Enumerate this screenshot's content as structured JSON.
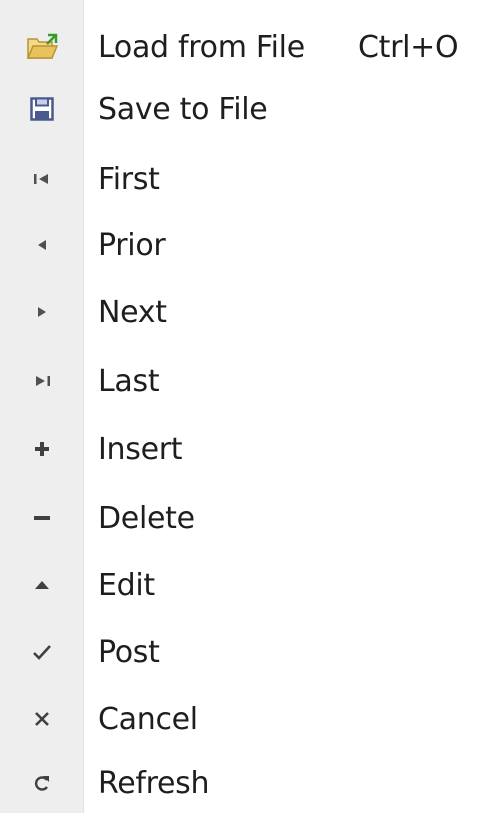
{
  "menu": {
    "items": [
      {
        "label": "Load from File",
        "shortcut": "Ctrl+O",
        "icon": "folder-open-icon"
      },
      {
        "label": "Save to File",
        "shortcut": "",
        "icon": "floppy-disk-icon"
      },
      {
        "label": "First",
        "shortcut": "",
        "icon": "first-record-icon"
      },
      {
        "label": "Prior",
        "shortcut": "",
        "icon": "prior-record-icon"
      },
      {
        "label": "Next",
        "shortcut": "",
        "icon": "next-record-icon"
      },
      {
        "label": "Last",
        "shortcut": "",
        "icon": "last-record-icon"
      },
      {
        "label": "Insert",
        "shortcut": "",
        "icon": "plus-icon"
      },
      {
        "label": "Delete",
        "shortcut": "",
        "icon": "minus-icon"
      },
      {
        "label": "Edit",
        "shortcut": "",
        "icon": "edit-triangle-icon"
      },
      {
        "label": "Post",
        "shortcut": "",
        "icon": "checkmark-icon"
      },
      {
        "label": "Cancel",
        "shortcut": "",
        "icon": "cross-icon"
      },
      {
        "label": "Refresh",
        "shortcut": "",
        "icon": "refresh-icon"
      }
    ]
  },
  "colors": {
    "gutter": "#eeeeee",
    "text": "#1e1e1e",
    "icon": "#505050",
    "folder": "#e8c25a",
    "folder_arrow": "#3a9a2a",
    "floppy": "#4a5a8c"
  }
}
